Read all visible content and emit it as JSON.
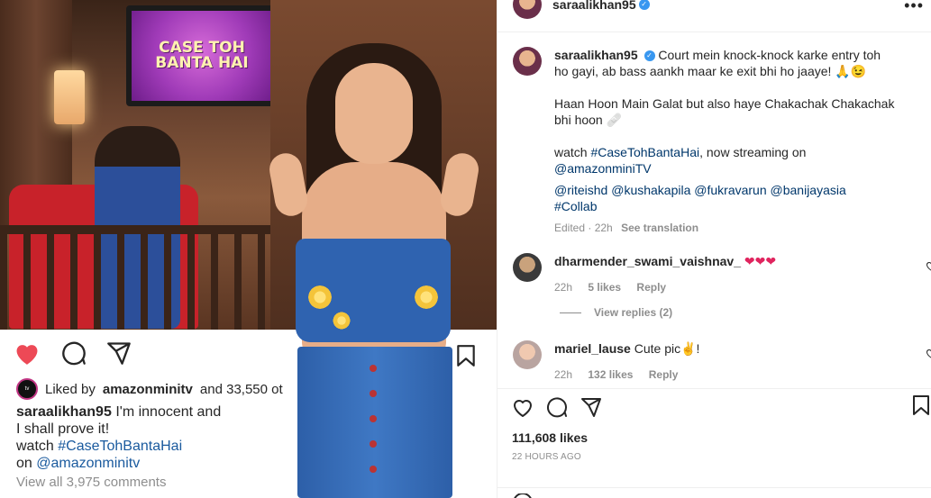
{
  "media": {
    "show_title": "CASE TOH BANTA HAI",
    "liked_by_prefix": "Liked by",
    "liked_by_user": "amazonminitv",
    "liked_by_suffix": "and 33,550 ot",
    "caption_user": "saraalikhan95",
    "caption_line1": "I'm innocent and",
    "caption_line2": "I shall prove it!",
    "caption_watch": "watch",
    "caption_hashtag": "#CaseTohBantaHai",
    "caption_on": "on",
    "caption_mention": "@amazonminitv",
    "view_all": "View all 3,975 comments"
  },
  "header": {
    "username": "saraalikhan95",
    "verified_icon": "✓",
    "more": "•••"
  },
  "caption": {
    "username": "saraalikhan95",
    "line1": "Court mein knock-knock karke entry toh ho gayi, ab bass aankh maar ke exit bhi ho jaaye! 🙏😉",
    "line2": "Haan Hoon Main Galat but also haye Chakachak Chakachak bhi hoon 🩹",
    "line3_prefix": "watch",
    "line3_hashtag": "#CaseTohBantaHai",
    "line3_mid": ", now streaming on",
    "line3_mention": "@amazonminiTV",
    "mentions": "@riteishd @kushakapila @fukravarun @banijayasia",
    "collab": "#Collab",
    "edited": "Edited · 22h",
    "see_translation": "See translation"
  },
  "comments": [
    {
      "username": "dharmender_swami_vaishnav_",
      "text": "❤❤❤",
      "time": "22h",
      "likes": "5 likes",
      "reply": "Reply"
    },
    {
      "username": "mariel_lause",
      "text": "Cute pic✌!",
      "time": "22h",
      "likes": "132 likes",
      "reply": "Reply"
    }
  ],
  "view_replies": "View replies (2)",
  "footer": {
    "likes": "111,608 likes",
    "time": "22 HOURS AGO"
  },
  "colors": {
    "like_red": "#ed4956",
    "link_blue": "#00376b",
    "verified_blue": "#3897f0"
  }
}
